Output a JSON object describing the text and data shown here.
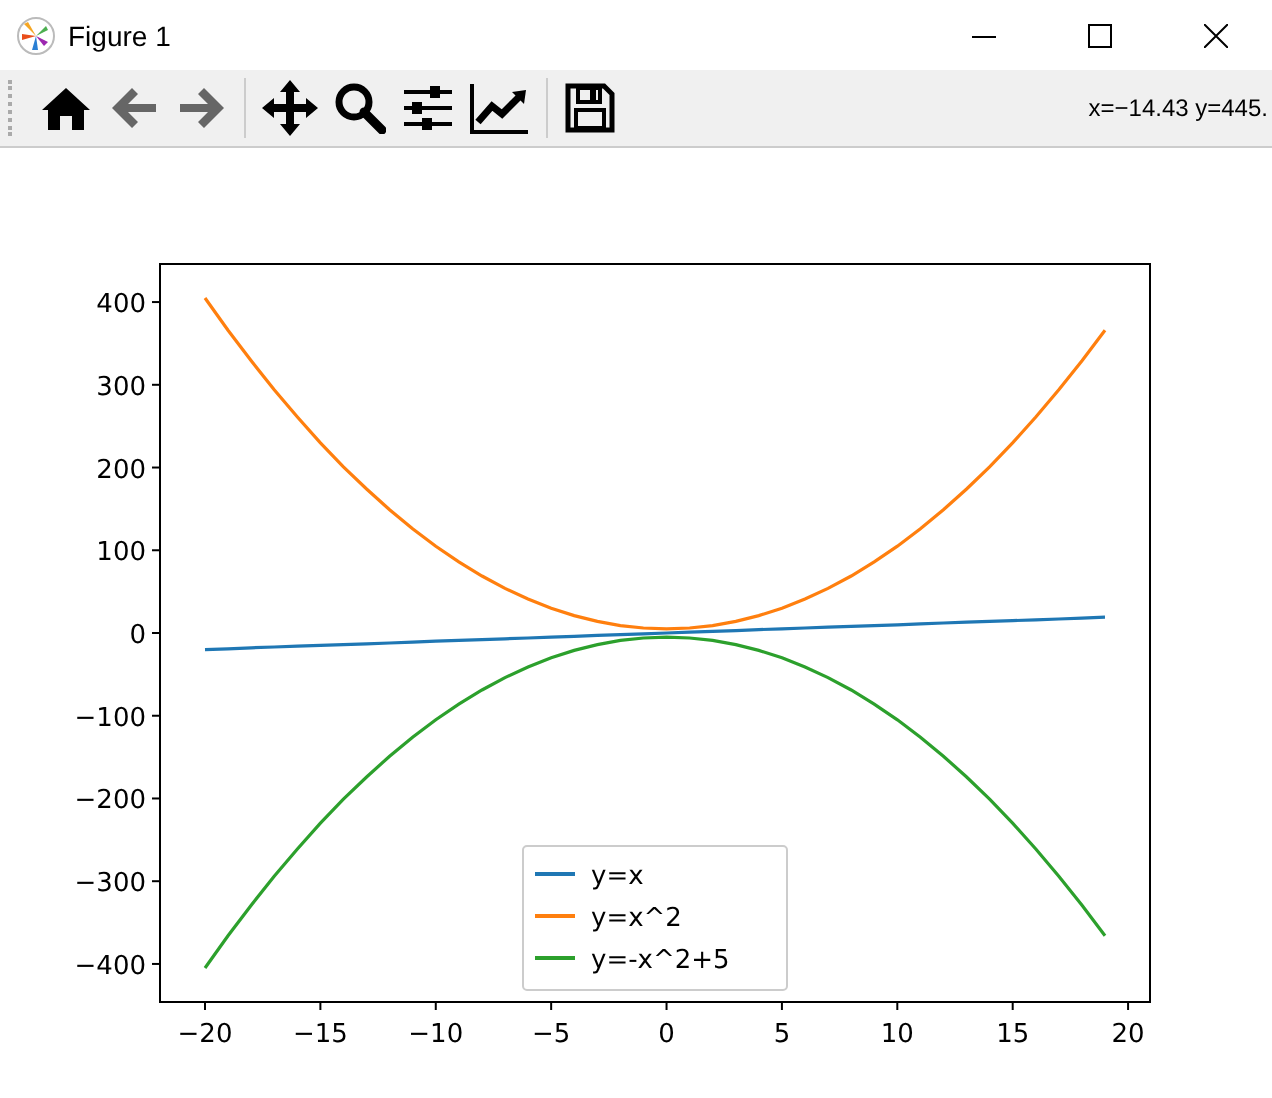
{
  "window": {
    "title": "Figure 1"
  },
  "toolbar": {
    "coordinates": "x=−14.43 y=445."
  },
  "plot": {
    "chart_data": {
      "type": "line",
      "x": [
        -20,
        -19,
        -18,
        -17,
        -16,
        -15,
        -14,
        -13,
        -12,
        -11,
        -10,
        -9,
        -8,
        -7,
        -6,
        -5,
        -4,
        -3,
        -2,
        -1,
        0,
        1,
        2,
        3,
        4,
        5,
        6,
        7,
        8,
        9,
        10,
        11,
        12,
        13,
        14,
        15,
        16,
        17,
        18,
        19
      ],
      "series": [
        {
          "name": "y=x",
          "color": "#1f77b4",
          "values": [
            -20,
            -19,
            -18,
            -17,
            -16,
            -15,
            -14,
            -13,
            -12,
            -11,
            -10,
            -9,
            -8,
            -7,
            -6,
            -5,
            -4,
            -3,
            -2,
            -1,
            0,
            1,
            2,
            3,
            4,
            5,
            6,
            7,
            8,
            9,
            10,
            11,
            12,
            13,
            14,
            15,
            16,
            17,
            18,
            19
          ]
        },
        {
          "name": "y=x^2",
          "color": "#ff7f0e",
          "values": [
            405,
            366,
            329,
            294,
            261,
            230,
            201,
            174,
            149,
            126,
            105,
            86,
            69,
            54,
            41,
            30,
            21,
            14,
            9,
            6,
            5,
            6,
            9,
            14,
            21,
            30,
            41,
            54,
            69,
            86,
            105,
            126,
            149,
            174,
            201,
            230,
            261,
            294,
            329,
            366
          ]
        },
        {
          "name": "y=-x^2+5",
          "color": "#2ca02c",
          "values": [
            -405,
            -366,
            -329,
            -294,
            -261,
            -230,
            -201,
            -174,
            -149,
            -126,
            -105,
            -86,
            -69,
            -54,
            -41,
            -30,
            -21,
            -14,
            -9,
            -6,
            -5,
            -6,
            -9,
            -14,
            -21,
            -30,
            -41,
            -54,
            -69,
            -86,
            -105,
            -126,
            -149,
            -174,
            -201,
            -230,
            -261,
            -294,
            -329,
            -366
          ]
        }
      ],
      "xlim": [
        -21.95,
        20.95
      ],
      "ylim": [
        -446,
        446
      ],
      "xticks": [
        {
          "value": -20,
          "label": "−20"
        },
        {
          "value": -15,
          "label": "−15"
        },
        {
          "value": -10,
          "label": "−10"
        },
        {
          "value": -5,
          "label": "−5"
        },
        0,
        5,
        10,
        15,
        20
      ],
      "legend": true,
      "yticks": [
        {
          "value": -400,
          "label": "−400"
        },
        {
          "value": -300,
          "label": "−300"
        },
        {
          "value": -200,
          "label": "−200"
        },
        {
          "value": -100,
          "label": "−100"
        },
        0,
        100,
        200,
        300,
        400
      ]
    }
  }
}
